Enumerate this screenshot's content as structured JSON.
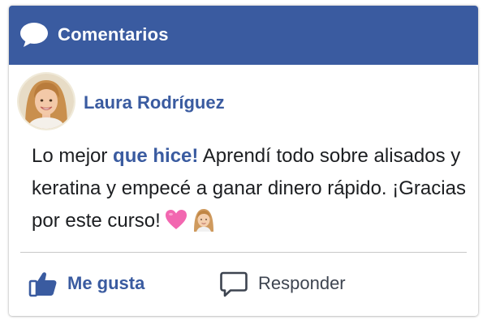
{
  "header": {
    "title": "Comentarios",
    "icon": "speech-bubble-icon",
    "background_color": "#3a5ba0"
  },
  "comment": {
    "author": "Laura Rodríguez",
    "text_before": "Lo mejor ",
    "text_highlight": "que hice!",
    "text_after": " Aprendí todo sobre alisados y keratina y empecé a ganar dinero rápido. ¡Gracias por este curso!",
    "emojis": [
      "pink-heart-emoji",
      "woman-face-emoji"
    ],
    "accent_color": "#3a5ba0"
  },
  "actions": {
    "like_label": "Me gusta",
    "like_icon": "thumbs-up-icon",
    "reply_label": "Responder",
    "reply_icon": "comment-bubble-icon"
  }
}
